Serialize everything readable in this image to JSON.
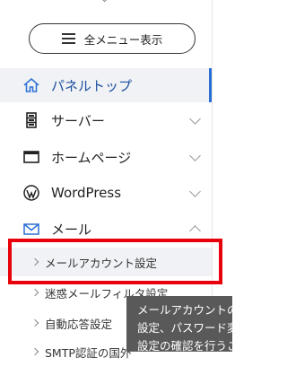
{
  "sidebar": {
    "all_menu_label": "全メニュー表示",
    "items": [
      {
        "label": "パネルトップ",
        "icon": "home-icon",
        "active": true
      },
      {
        "label": "サーバー",
        "icon": "server-icon",
        "chevron": "down"
      },
      {
        "label": "ホームページ",
        "icon": "browser-window-icon",
        "chevron": "down"
      },
      {
        "label": "WordPress",
        "icon": "wordpress-icon",
        "chevron": "down"
      },
      {
        "label": "メール",
        "icon": "mail-icon",
        "chevron": "up"
      }
    ],
    "mail_submenu": [
      {
        "label": "メールアカウント設定",
        "highlighted": true
      },
      {
        "label": "迷惑メールフィルタ設定"
      },
      {
        "label": "自動応答設定"
      },
      {
        "label": "SMTP認証の国外"
      }
    ]
  },
  "tooltip": {
    "lines": [
      "メールアカウントの",
      "設定、パスワード変",
      "設定の確認を行うこ"
    ]
  },
  "colors": {
    "accent": "#2a6fd6",
    "highlight_box": "#e8000b",
    "tooltip_bg": "#595959",
    "active_bg": "#f0f2f5"
  }
}
